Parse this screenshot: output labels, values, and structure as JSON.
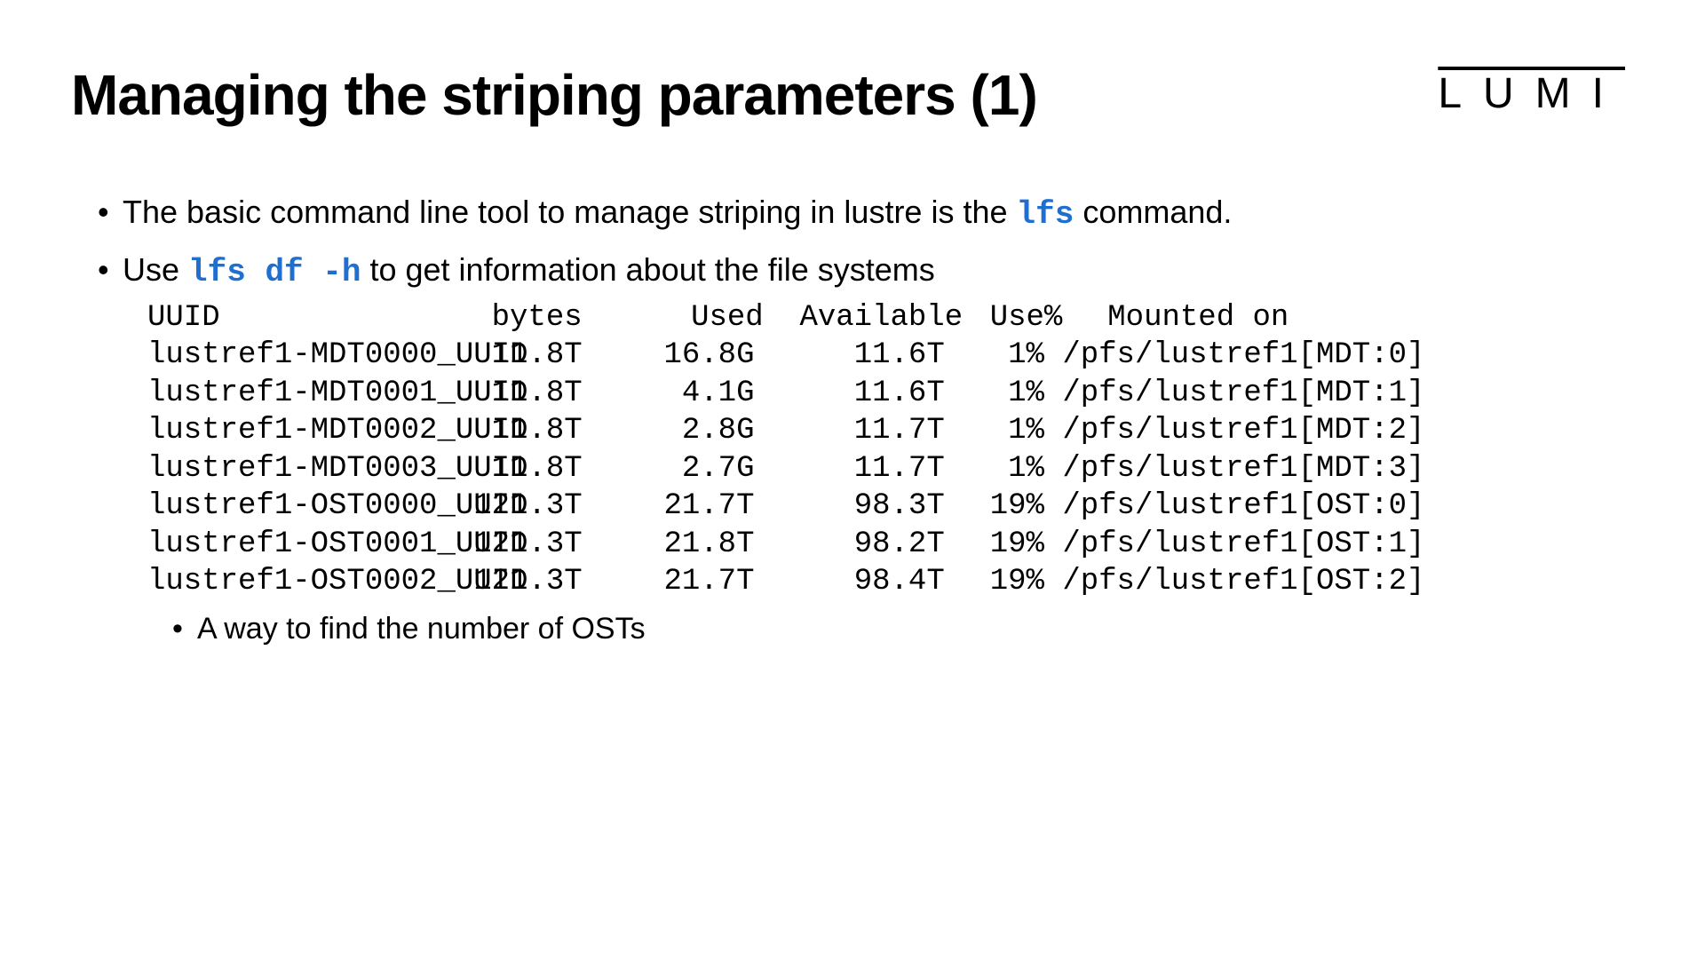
{
  "logo": "LUMI",
  "title": "Managing the striping parameters (1)",
  "bullet1": {
    "pre": "The basic command line tool to manage striping in lustre is the ",
    "code": "lfs",
    "post": " command."
  },
  "bullet2": {
    "pre": "Use ",
    "code": "lfs df -h",
    "post": " to get information about the file systems"
  },
  "table": {
    "headers": {
      "uuid": "UUID",
      "bytes": "bytes",
      "used": "Used",
      "avail": "Available",
      "usep": "Use%",
      "mnt": "Mounted on"
    },
    "rows": [
      {
        "uuid": "lustref1-MDT0000_UUID",
        "bytes": "11.8T",
        "used": "16.8G",
        "avail": "11.6T",
        "usep": "1%",
        "mnt": "/pfs/lustref1[MDT:0]"
      },
      {
        "uuid": "lustref1-MDT0001_UUID",
        "bytes": "11.8T",
        "used": "4.1G",
        "avail": "11.6T",
        "usep": "1%",
        "mnt": "/pfs/lustref1[MDT:1]"
      },
      {
        "uuid": "lustref1-MDT0002_UUID",
        "bytes": "11.8T",
        "used": "2.8G",
        "avail": "11.7T",
        "usep": "1%",
        "mnt": "/pfs/lustref1[MDT:2]"
      },
      {
        "uuid": "lustref1-MDT0003_UUID",
        "bytes": "11.8T",
        "used": "2.7G",
        "avail": "11.7T",
        "usep": "1%",
        "mnt": "/pfs/lustref1[MDT:3]"
      },
      {
        "uuid": "lustref1-OST0000_UUID",
        "bytes": "121.3T",
        "used": "21.7T",
        "avail": "98.3T",
        "usep": "19%",
        "mnt": "/pfs/lustref1[OST:0]"
      },
      {
        "uuid": "lustref1-OST0001_UUID",
        "bytes": "121.3T",
        "used": "21.8T",
        "avail": "98.2T",
        "usep": "19%",
        "mnt": "/pfs/lustref1[OST:1]"
      },
      {
        "uuid": "lustref1-OST0002_UUID",
        "bytes": "121.3T",
        "used": "21.7T",
        "avail": "98.4T",
        "usep": "19%",
        "mnt": "/pfs/lustref1[OST:2]"
      }
    ]
  },
  "subbullet": "A way to find the number of OSTs"
}
